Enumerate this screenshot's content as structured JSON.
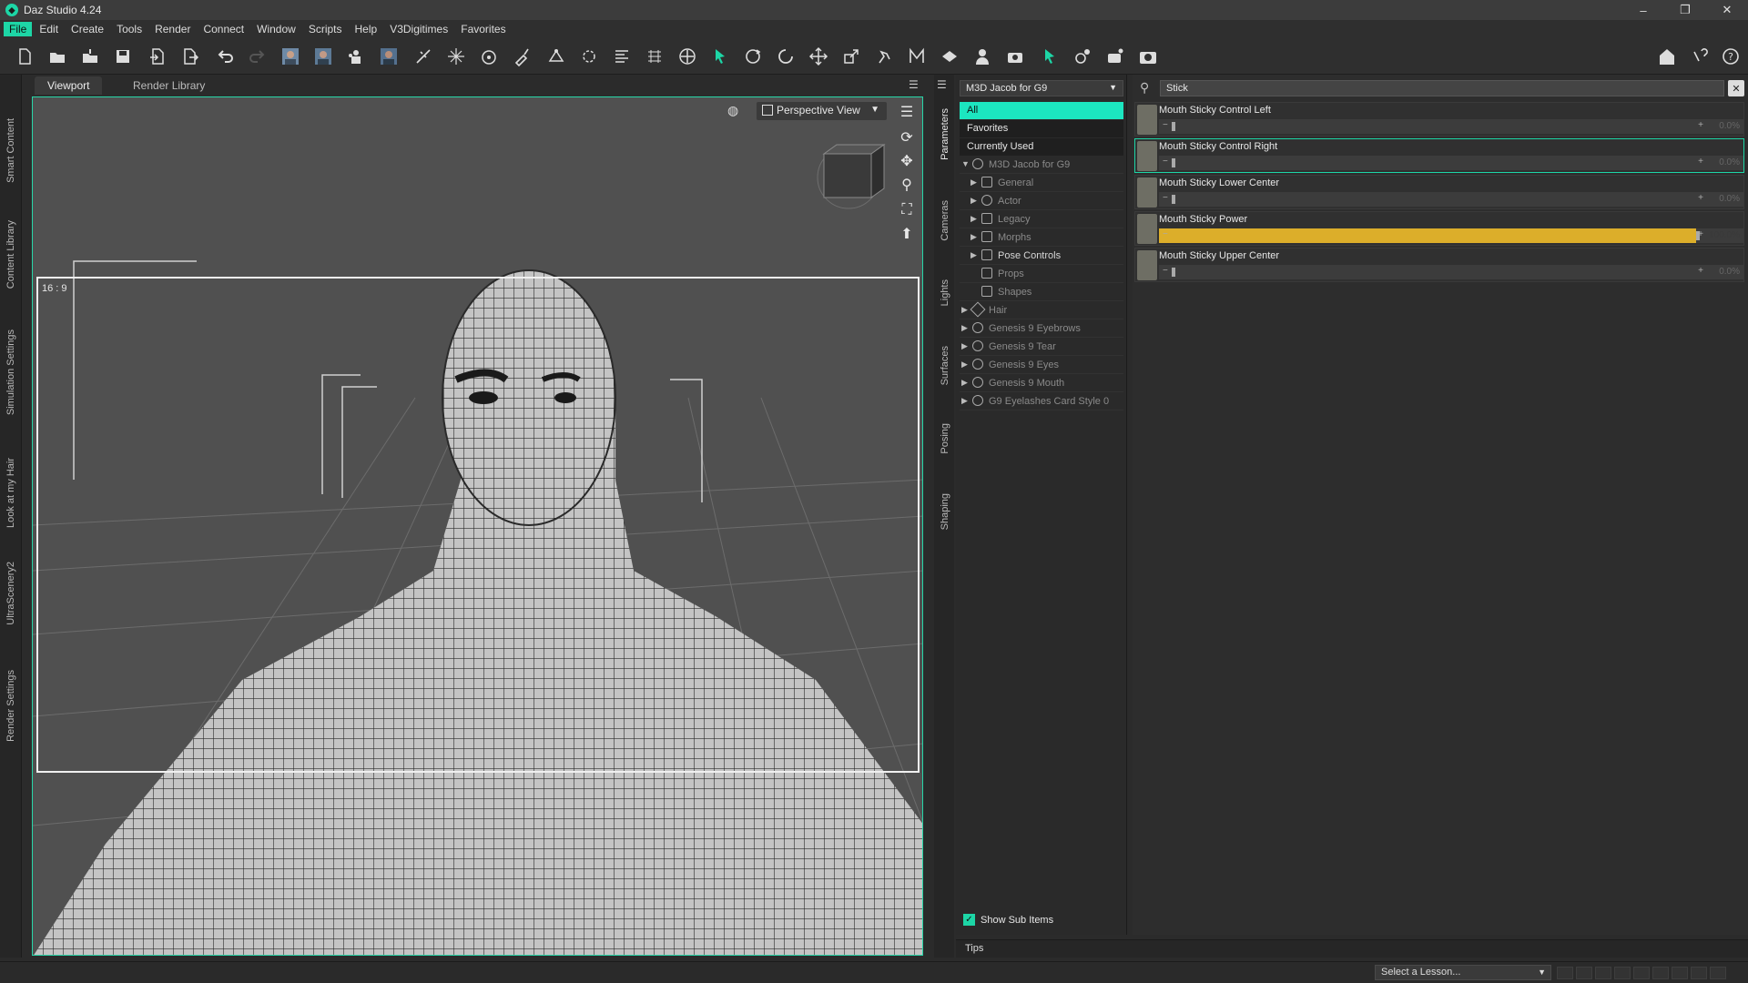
{
  "window": {
    "title": "Daz Studio 4.24",
    "controls": [
      "–",
      "❐",
      "✕"
    ]
  },
  "menu": [
    "File",
    "Edit",
    "Create",
    "Tools",
    "Render",
    "Connect",
    "Window",
    "Scripts",
    "Help",
    "V3Digitimes",
    "Favorites"
  ],
  "left_tabs": [
    "Smart Content",
    "Content Library",
    "Simulation Settings",
    "Look at my Hair",
    "UltraScenery2",
    "Render Settings"
  ],
  "view_tabs": [
    "Viewport",
    "Render Library"
  ],
  "viewport": {
    "camera": "Perspective View",
    "aspect": "16 : 9"
  },
  "mid_tabs": [
    "Parameters",
    "Cameras",
    "Lights",
    "Surfaces",
    "Posing",
    "Shaping"
  ],
  "tree": {
    "figure": "M3D Jacob for G9",
    "filters": [
      "All",
      "Favorites",
      "Currently Used"
    ],
    "root": "M3D Jacob for G9",
    "nodes": [
      "General",
      "Actor",
      "Legacy",
      "Morphs",
      "Pose Controls",
      "Props",
      "Shapes",
      "Hair",
      "Genesis 9 Eyebrows",
      "Genesis 9 Tear",
      "Genesis 9 Eyes",
      "Genesis 9 Mouth",
      "G9 Eyelashes Card Style 0"
    ],
    "show_sub_items": "Show Sub Items"
  },
  "params": {
    "search_value": "Stick",
    "items": [
      {
        "name": "Mouth Sticky Control Left",
        "value": "0.0%",
        "fraction": 0
      },
      {
        "name": "Mouth Sticky Control Right",
        "value": "0.0%",
        "fraction": 0
      },
      {
        "name": "Mouth Sticky Lower Center",
        "value": "0.0%",
        "fraction": 0
      },
      {
        "name": "Mouth Sticky Power",
        "value": "100.0%",
        "fraction": 1
      },
      {
        "name": "Mouth Sticky Upper Center",
        "value": "0.0%",
        "fraction": 0
      }
    ]
  },
  "tips": "Tips",
  "lesson": "Select a Lesson...",
  "colors": {
    "accent": "#1dd6a6",
    "slider_active": "#dcae2a"
  }
}
